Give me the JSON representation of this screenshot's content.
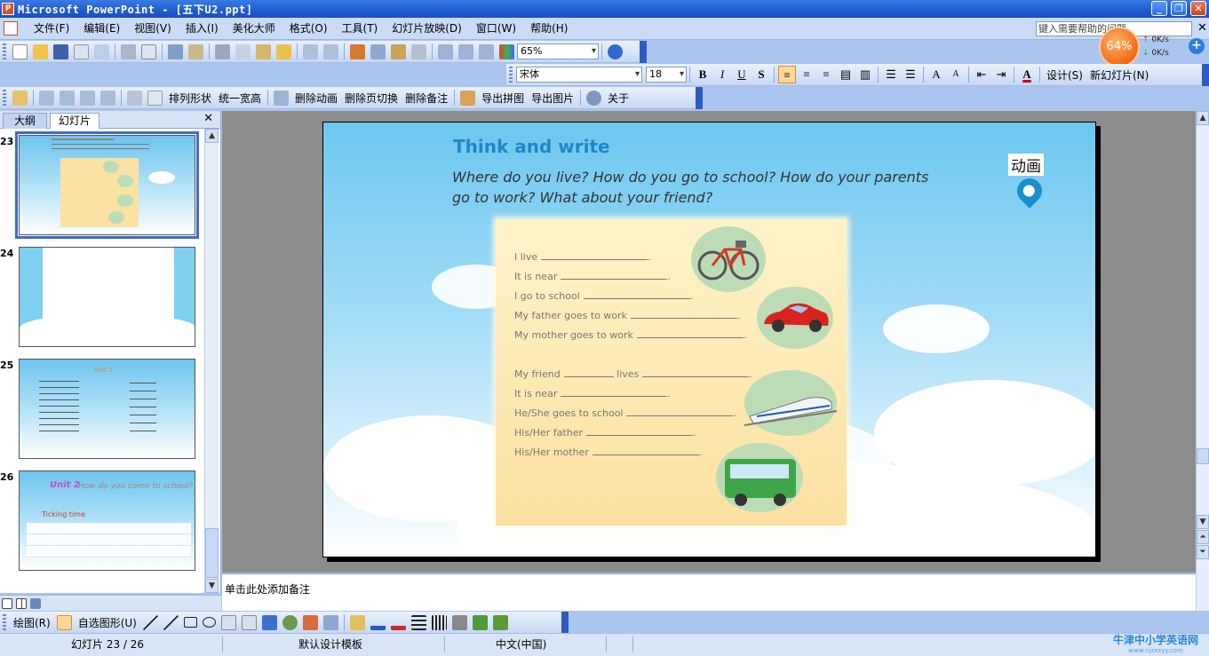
{
  "window": {
    "title": "Microsoft PowerPoint - [五下U2.ppt]",
    "minimize_glyph": "_",
    "restore_glyph": "❐",
    "close_glyph": "✕"
  },
  "menu": {
    "items": [
      "文件(F)",
      "编辑(E)",
      "视图(V)",
      "插入(I)",
      "美化大师",
      "格式(O)",
      "工具(T)",
      "幻灯片放映(D)",
      "窗口(W)",
      "帮助(H)"
    ],
    "help_placeholder": "键入需要帮助的问题",
    "close_glyph": "✕"
  },
  "standard_toolbar": {
    "zoom": "65%"
  },
  "format_toolbar": {
    "font": "宋体",
    "size": "18",
    "bold": "B",
    "italic": "I",
    "underline": "U",
    "shadow": "S",
    "design_label": "设计(S)",
    "new_slide_label": "新幻灯片(N)"
  },
  "network_widget": {
    "percent": "64%",
    "up_speed": "0K/s",
    "down_speed": "0K/s",
    "plus": "+"
  },
  "beautify_toolbar": {
    "items": [
      "排列形状",
      "统一宽高",
      "删除动画",
      "删除页切换",
      "删除备注",
      "导出拼图",
      "导出图片",
      "关于"
    ]
  },
  "left_panel": {
    "tab_outline": "大纲",
    "tab_slides": "幻灯片",
    "close_glyph": "✕",
    "slides": [
      {
        "number": "23",
        "selected": true
      },
      {
        "number": "24",
        "selected": false
      },
      {
        "number": "25",
        "selected": false
      },
      {
        "number": "26",
        "selected": false
      }
    ],
    "thumb26": {
      "unit": "Unit 2",
      "title": "How do you come to school?",
      "ticking": "Ticking time"
    },
    "thumb25": {
      "unit": "Unit 2"
    }
  },
  "slide": {
    "title": "Think and write",
    "question": "Where do you live? How do you go to school? How do your parents go to work? What about your friend?",
    "animation_label": "动画",
    "lines": [
      {
        "text": "I live",
        "blank_after": "."
      },
      {
        "text": "It is near",
        "blank_after": "."
      },
      {
        "text": "I go to school",
        "blank_after": "."
      },
      {
        "text": "My father goes to work",
        "blank_after": "."
      },
      {
        "text": "My mother goes to work",
        "blank_after": "."
      },
      {
        "text": "My friend",
        "middle": "lives",
        "blank_after": "."
      },
      {
        "text": "It is near",
        "blank_after": "."
      },
      {
        "text": "He/She goes to school",
        "blank_after": "."
      },
      {
        "text": "His/Her father",
        "blank_after": "."
      },
      {
        "text": "His/Her mother",
        "blank_after": "."
      }
    ],
    "pictures": [
      "bicycle",
      "car",
      "train",
      "bus"
    ]
  },
  "notes": {
    "placeholder": "单击此处添加备注"
  },
  "draw_toolbar": {
    "draw_label": "绘图(R)",
    "autoshape_label": "自选图形(U)"
  },
  "status": {
    "slide_info": "幻灯片 23 / 26",
    "design_template": "默认设计模板",
    "language": "中文(中国)"
  },
  "watermark": {
    "text": "牛津中小学英语网",
    "url": "www.njzxxyy.com"
  }
}
